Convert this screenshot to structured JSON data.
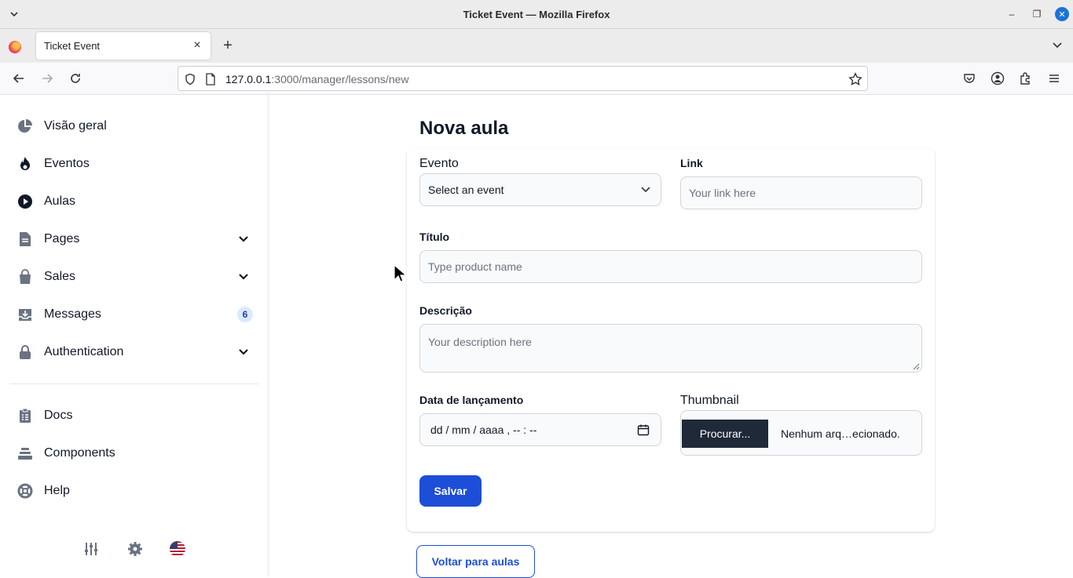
{
  "window": {
    "title": "Ticket Event — Mozilla Firefox"
  },
  "tab": {
    "label": "Ticket Event"
  },
  "url": {
    "host": "127.0.0.1",
    "rest": ":3000/manager/lessons/new"
  },
  "sidebar": {
    "items": [
      {
        "label": "Visão geral"
      },
      {
        "label": "Eventos"
      },
      {
        "label": "Aulas"
      },
      {
        "label": "Pages"
      },
      {
        "label": "Sales"
      },
      {
        "label": "Messages",
        "badge": "6"
      },
      {
        "label": "Authentication"
      },
      {
        "label": "Docs"
      },
      {
        "label": "Components"
      },
      {
        "label": "Help"
      }
    ]
  },
  "form": {
    "title": "Nova aula",
    "evento_label": "Evento",
    "evento_value": "Select an event",
    "link_label": "Link",
    "link_placeholder": "Your link here",
    "titulo_label": "Título",
    "titulo_placeholder": "Type product name",
    "descricao_label": "Descrição",
    "descricao_placeholder": "Your description here",
    "data_label": "Data de lançamento",
    "data_placeholder": "dd / mm / aaaa ,  -- : --",
    "thumbnail_label": "Thumbnail",
    "file_button": "Procurar...",
    "file_name": "Nenhum arq…ecionado.",
    "save_label": "Salvar",
    "back_label": "Voltar para aulas"
  },
  "colors": {
    "primary": "#1d4ed8",
    "dark": "#1f2937",
    "icon": "#6b7280"
  }
}
